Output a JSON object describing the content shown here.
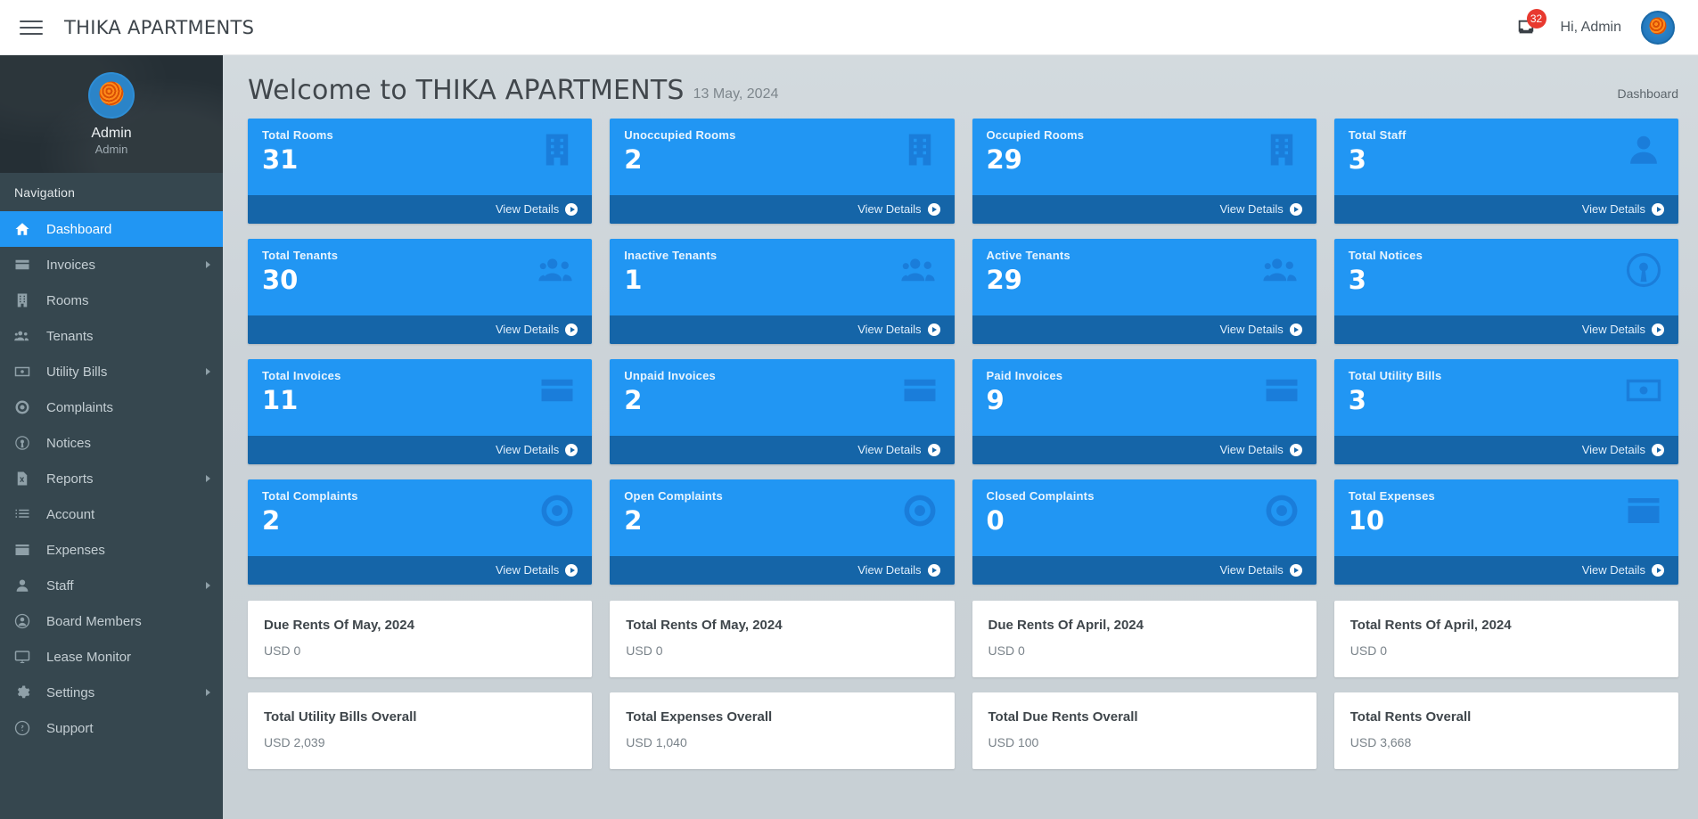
{
  "topbar": {
    "menu_icon": "hamburger-icon",
    "brand": "THIKA APARTMENTS",
    "notification_icon": "inbox-icon",
    "notification_count": "32",
    "greeting": "Hi, Admin",
    "avatar": "user-avatar"
  },
  "sidebar": {
    "profile": {
      "name": "Admin",
      "role": "Admin"
    },
    "heading": "Navigation",
    "items": [
      {
        "label": "Dashboard",
        "icon": "home-icon",
        "active": true,
        "has_submenu": false
      },
      {
        "label": "Invoices",
        "icon": "credit-card-icon",
        "active": false,
        "has_submenu": true
      },
      {
        "label": "Rooms",
        "icon": "building-icon",
        "active": false,
        "has_submenu": false
      },
      {
        "label": "Tenants",
        "icon": "users-icon",
        "active": false,
        "has_submenu": false
      },
      {
        "label": "Utility Bills",
        "icon": "money-bill-icon",
        "active": false,
        "has_submenu": true
      },
      {
        "label": "Complaints",
        "icon": "life-ring-icon",
        "active": false,
        "has_submenu": false
      },
      {
        "label": "Notices",
        "icon": "broadcast-icon",
        "active": false,
        "has_submenu": false
      },
      {
        "label": "Reports",
        "icon": "file-excel-icon",
        "active": false,
        "has_submenu": true
      },
      {
        "label": "Account",
        "icon": "list-icon",
        "active": false,
        "has_submenu": false
      },
      {
        "label": "Expenses",
        "icon": "expense-card-icon",
        "active": false,
        "has_submenu": false
      },
      {
        "label": "Staff",
        "icon": "user-icon",
        "active": false,
        "has_submenu": true
      },
      {
        "label": "Board Members",
        "icon": "user-circle-icon",
        "active": false,
        "has_submenu": false
      },
      {
        "label": "Lease Monitor",
        "icon": "monitor-icon",
        "active": false,
        "has_submenu": false
      },
      {
        "label": "Settings",
        "icon": "gear-icon",
        "active": false,
        "has_submenu": true
      },
      {
        "label": "Support",
        "icon": "question-icon",
        "active": false,
        "has_submenu": false
      }
    ]
  },
  "main": {
    "title": "Welcome to THIKA APARTMENTS",
    "date": "13 May, 2024",
    "breadcrumb": "Dashboard",
    "view_details_label": "View Details",
    "stat_cards": [
      {
        "label": "Total Rooms",
        "value": "31",
        "icon": "building-icon"
      },
      {
        "label": "Unoccupied Rooms",
        "value": "2",
        "icon": "building-icon"
      },
      {
        "label": "Occupied Rooms",
        "value": "29",
        "icon": "building-icon"
      },
      {
        "label": "Total Staff",
        "value": "3",
        "icon": "user-icon"
      },
      {
        "label": "Total Tenants",
        "value": "30",
        "icon": "users-icon"
      },
      {
        "label": "Inactive Tenants",
        "value": "1",
        "icon": "users-icon"
      },
      {
        "label": "Active Tenants",
        "value": "29",
        "icon": "users-icon"
      },
      {
        "label": "Total Notices",
        "value": "3",
        "icon": "broadcast-icon"
      },
      {
        "label": "Total Invoices",
        "value": "11",
        "icon": "credit-card-icon"
      },
      {
        "label": "Unpaid Invoices",
        "value": "2",
        "icon": "credit-card-icon"
      },
      {
        "label": "Paid Invoices",
        "value": "9",
        "icon": "credit-card-icon"
      },
      {
        "label": "Total Utility Bills",
        "value": "3",
        "icon": "money-bill-icon"
      },
      {
        "label": "Total Complaints",
        "value": "2",
        "icon": "life-ring-icon"
      },
      {
        "label": "Open Complaints",
        "value": "2",
        "icon": "life-ring-icon"
      },
      {
        "label": "Closed Complaints",
        "value": "0",
        "icon": "life-ring-icon"
      },
      {
        "label": "Total Expenses",
        "value": "10",
        "icon": "expense-card-icon"
      }
    ],
    "summary_cards": [
      {
        "title": "Due Rents Of May, 2024",
        "value": "USD 0"
      },
      {
        "title": "Total Rents Of May, 2024",
        "value": "USD 0"
      },
      {
        "title": "Due Rents Of April, 2024",
        "value": "USD 0"
      },
      {
        "title": "Total Rents Of April, 2024",
        "value": "USD 0"
      },
      {
        "title": "Total Utility Bills Overall",
        "value": "USD 2,039"
      },
      {
        "title": "Total Expenses Overall",
        "value": "USD 1,040"
      },
      {
        "title": "Total Due Rents Overall",
        "value": "USD 100"
      },
      {
        "title": "Total Rents Overall",
        "value": "USD 3,668"
      }
    ]
  },
  "colors": {
    "card_blue": "#2196f3",
    "card_footer_blue": "#1565a8",
    "sidebar": "#36474f",
    "badge_red": "#e8392f",
    "page_bg": "#ccd3d8"
  }
}
